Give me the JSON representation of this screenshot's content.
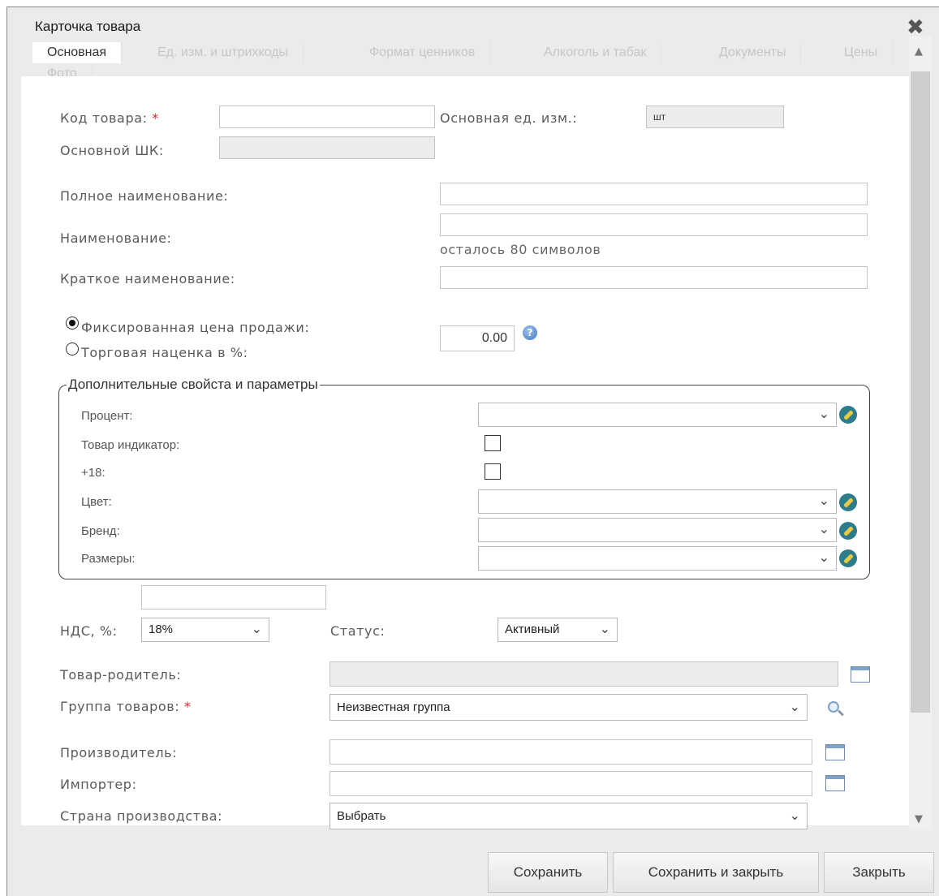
{
  "window": {
    "title": "Карточка товара"
  },
  "tabs": [
    {
      "label": "Основная",
      "active": true
    },
    {
      "label": "Ед. изм. и штрихкоды"
    },
    {
      "label": "Формат ценников"
    },
    {
      "label": "Алкоголь и табак"
    },
    {
      "label": "Документы"
    },
    {
      "label": "Цены"
    },
    {
      "label": "Фото"
    }
  ],
  "form": {
    "code_label": "Код товара:",
    "required_mark": "*",
    "code_value": "",
    "base_unit_label": "Основная ед. изм.:",
    "base_unit_value": "шт",
    "barcode_label": "Основной ШК:",
    "barcode_value": "",
    "full_name_label": "Полное наименование:",
    "full_name_value": "",
    "name_label": "Наименование:",
    "name_value": "",
    "name_hint": "осталось 80 символов",
    "short_name_label": "Краткое наименование:",
    "short_name_value": "",
    "fixed_price_label": "Фиксированная цена продажи:",
    "markup_label": "Торговая наценка в %:",
    "price_value": "0.00",
    "price_mode": "fixed"
  },
  "extra": {
    "legend": "Дополнительные свойста и параметры",
    "percent_label": "Процент:",
    "indicator_label": "Товар индикатор:",
    "adult_label": "+18:",
    "color_label": "Цвет:",
    "brand_label": "Бренд:",
    "sizes_label": "Размеры:"
  },
  "vat": {
    "label": "НДС, %:",
    "value": "18%",
    "extra_value": ""
  },
  "status": {
    "label": "Статус:",
    "value": "Активный"
  },
  "parent": {
    "label": "Товар-родитель:",
    "value": ""
  },
  "group": {
    "label": "Группа товаров:",
    "value": "Неизвестная группа"
  },
  "manufacturer": {
    "label": "Производитель:",
    "value": ""
  },
  "importer": {
    "label": "Импортер:",
    "value": ""
  },
  "country": {
    "label": "Страна производства:",
    "value": "Выбрать"
  },
  "footer": {
    "save": "Сохранить",
    "save_close": "Сохранить и закрыть",
    "close": "Закрыть"
  },
  "icons": {
    "close": "close-icon",
    "edit": "edit-icon",
    "calendar": "calendar-icon",
    "search": "search-icon",
    "help": "help-icon"
  },
  "colors": {
    "required": "#d9232a",
    "edit_icon": "#2c7c8c"
  }
}
